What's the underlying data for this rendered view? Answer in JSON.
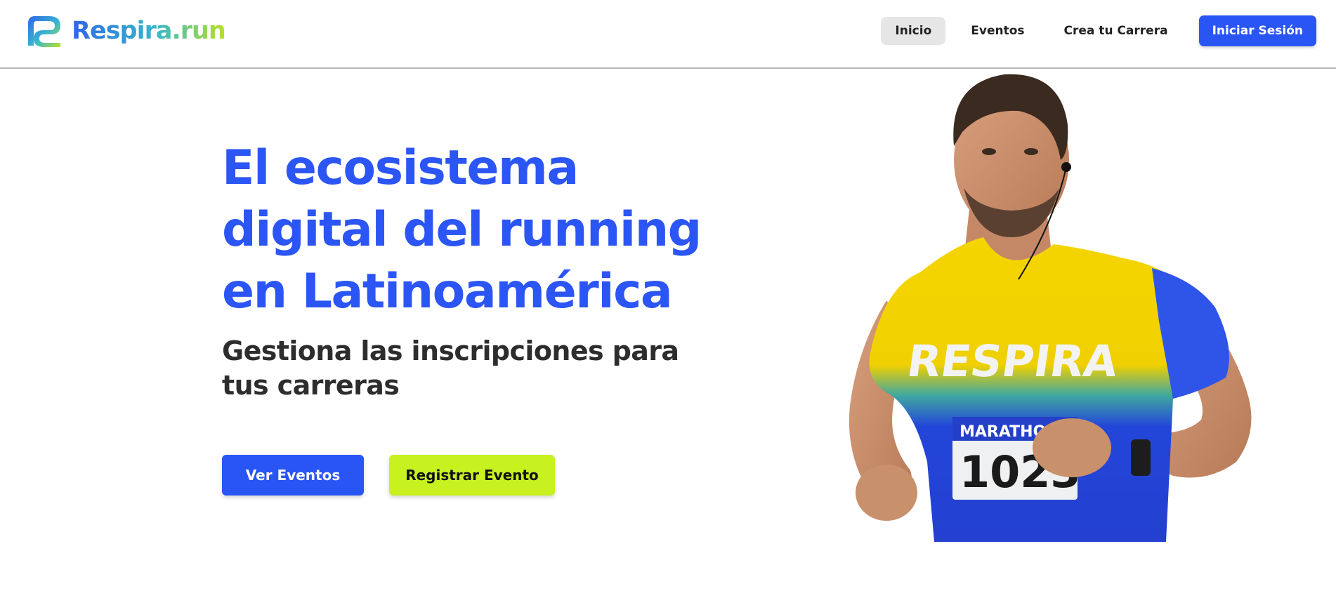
{
  "header": {
    "logo_text": "Respira.run",
    "logo_icon": "respira-logo-mark",
    "nav": [
      {
        "label": "Inicio",
        "active": true
      },
      {
        "label": "Eventos",
        "active": false
      },
      {
        "label": "Crea tu Carrera",
        "active": false
      }
    ],
    "login_label": "Iniciar Sesión"
  },
  "hero": {
    "title_lines": [
      "El ecosistema",
      "digital del running",
      "en Latinoamérica"
    ],
    "subtitle_lines": [
      "Gestiona las inscripciones para",
      "tus carreras"
    ],
    "primary_cta": "Ver Eventos",
    "secondary_cta": "Registrar Evento"
  },
  "runner_image": {
    "shirt_text": "RESPIRA",
    "bib_label": "MARATHON",
    "bib_number": "1023"
  },
  "colors": {
    "brand_blue": "#2a55f5",
    "accent_lime": "#c8f21f",
    "heading_blue": "#2b55f4",
    "text_dark": "#2d2d2d"
  }
}
